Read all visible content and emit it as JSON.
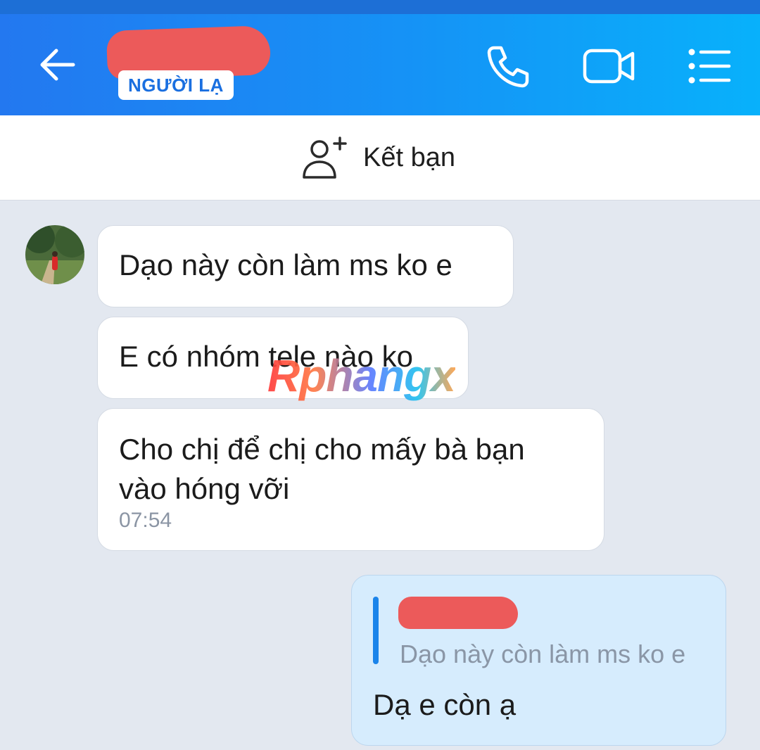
{
  "header": {
    "badge": "NGƯỜI LẠ",
    "icons": [
      "back-arrow-icon",
      "phone-icon",
      "video-icon",
      "menu-list-icon"
    ]
  },
  "add_friend": {
    "label": "Kết bạn",
    "icon": "add-person-icon"
  },
  "messages": {
    "m1": "Dạo này còn làm ms ko e",
    "m2": "E có nhóm tele nào ko",
    "m3": "Cho chị để chị cho mấy bà bạn\nvào hóng vỡi",
    "m3_time": "07:54"
  },
  "reply": {
    "quoted_text": "Dạo này còn làm ms ko e",
    "text": "Dạ e còn ạ"
  },
  "watermark": "Rphangx",
  "colors": {
    "header_start": "#2378f0",
    "header_end": "#08b1fb",
    "outgoing_bubble": "#d6ecfd",
    "redaction": "#ec5a5a"
  }
}
